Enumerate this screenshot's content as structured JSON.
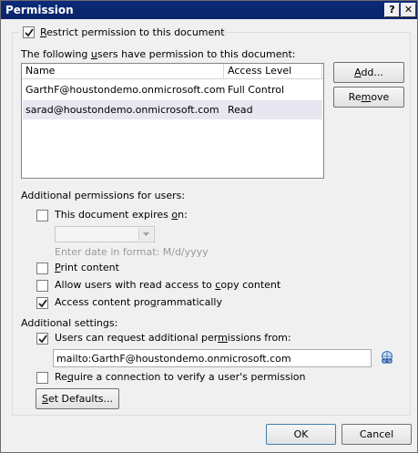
{
  "window": {
    "title": "Permission",
    "help_label": "?",
    "close_label": "✕"
  },
  "restrict": {
    "checked": true,
    "label_pre": "",
    "label_u": "R",
    "label_post": "estrict permission to this document"
  },
  "users_section": {
    "label_pre": "The following ",
    "label_u": "u",
    "label_post": "sers have permission to this document:",
    "columns": [
      "Name",
      "Access Level"
    ],
    "rows": [
      {
        "name": "GarthF@houstondemo.onmicrosoft.com",
        "access": "Full Control"
      },
      {
        "name": "sarad@houstondemo.onmicrosoft.com",
        "access": "Read"
      }
    ],
    "add_button": {
      "pre": "",
      "u": "A",
      "post": "dd..."
    },
    "remove_button": {
      "pre": "Re",
      "u": "m",
      "post": "ove"
    }
  },
  "additional_permissions": {
    "heading": "Additional permissions for users:",
    "expires": {
      "checked": false,
      "pre": "This document expires ",
      "u": "o",
      "post": "n:"
    },
    "date_hint": "Enter date in format: M/d/yyyy",
    "print": {
      "checked": false,
      "pre": "",
      "u": "P",
      "post": "rint content"
    },
    "copy": {
      "checked": false,
      "pre": "Allow users with read access to ",
      "u": "c",
      "post": "opy content"
    },
    "programmatic": {
      "checked": true,
      "pre": "Access content pro",
      "u": "g",
      "post": "rammatically"
    }
  },
  "additional_settings": {
    "heading": "Additional settings:",
    "request": {
      "checked": true,
      "pre": "Users can request additional per",
      "u": "m",
      "post": "issions from:"
    },
    "request_value": "mailto:GarthF@houstondemo.onmicrosoft.com",
    "require_connection": {
      "checked": false,
      "pre": "Re",
      "u": "q",
      "post": "uire a connection to verify a user's permission"
    },
    "set_defaults": {
      "pre": "",
      "u": "S",
      "post": "et Defaults..."
    }
  },
  "footer": {
    "ok_label": "OK",
    "cancel_label": "Cancel"
  },
  "colors": {
    "titlebar": "#0a246a",
    "dialog_bg": "#f0f0f0",
    "selected_row": "#e8e6f0"
  }
}
